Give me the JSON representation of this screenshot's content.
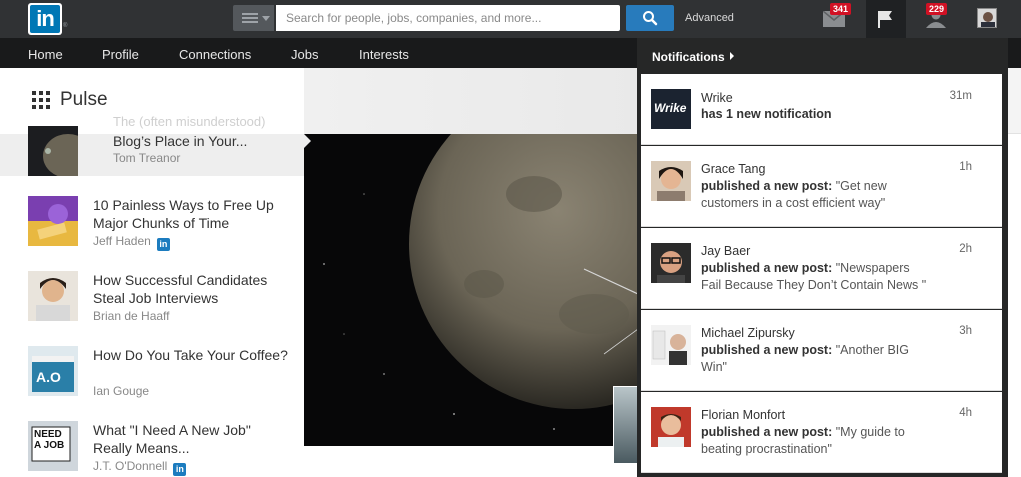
{
  "topbar": {
    "logo_text": "in",
    "search_placeholder": "Search for people, jobs, companies, and more...",
    "advanced_label": "Advanced",
    "messages_count": "341",
    "connections_count": "229"
  },
  "subnav": {
    "items": [
      "Home",
      "Profile",
      "Connections",
      "Jobs",
      "Interests"
    ]
  },
  "pulse": {
    "title": "Pulse",
    "fade_text": "The (often misunderstood)",
    "articles": [
      {
        "title": "Blog’s Place in Your...",
        "author": "Tom Treanor",
        "badge": false
      },
      {
        "title": "10 Painless Ways to Free Up Major Chunks of Time",
        "author": "Jeff Haden",
        "badge": true
      },
      {
        "title": "How Successful Candidates Steal Job Interviews",
        "author": "Brian de Haaff",
        "badge": false
      },
      {
        "title": "How Do You Take Your Coffee?",
        "author": "Ian Gouge",
        "badge": false
      },
      {
        "title": "What \"I Need A New Job\" Really Means...",
        "author": "J.T. O'Donnell",
        "badge": true
      }
    ],
    "badge_text": "in",
    "thumb_need_job": "NEED A JOB"
  },
  "notifications": {
    "header": "Notifications",
    "items": [
      {
        "name": "Wrike",
        "time": "31m",
        "action": "has 1 new notification",
        "quote": "",
        "avatar_text": "Wrike"
      },
      {
        "name": "Grace Tang",
        "time": "1h",
        "action": "published a new post:",
        "quote": "\"Get new customers in a cost efficient way\""
      },
      {
        "name": "Jay Baer",
        "time": "2h",
        "action": "published a new post:",
        "quote": "\"Newspapers Fail Because They Don’t Contain News \""
      },
      {
        "name": "Michael Zipursky",
        "time": "3h",
        "action": "published a new post:",
        "quote": "\"Another BIG Win\""
      },
      {
        "name": "Florian Monfort",
        "time": "4h",
        "action": "published a new post:",
        "quote": "\"My guide to beating procrastination\""
      }
    ]
  },
  "colors": {
    "topbar": "#303234",
    "subnav": "#191a1b",
    "linkedin_blue": "#0077b5",
    "search_button": "#287bbc",
    "badge_red": "#d11124"
  }
}
